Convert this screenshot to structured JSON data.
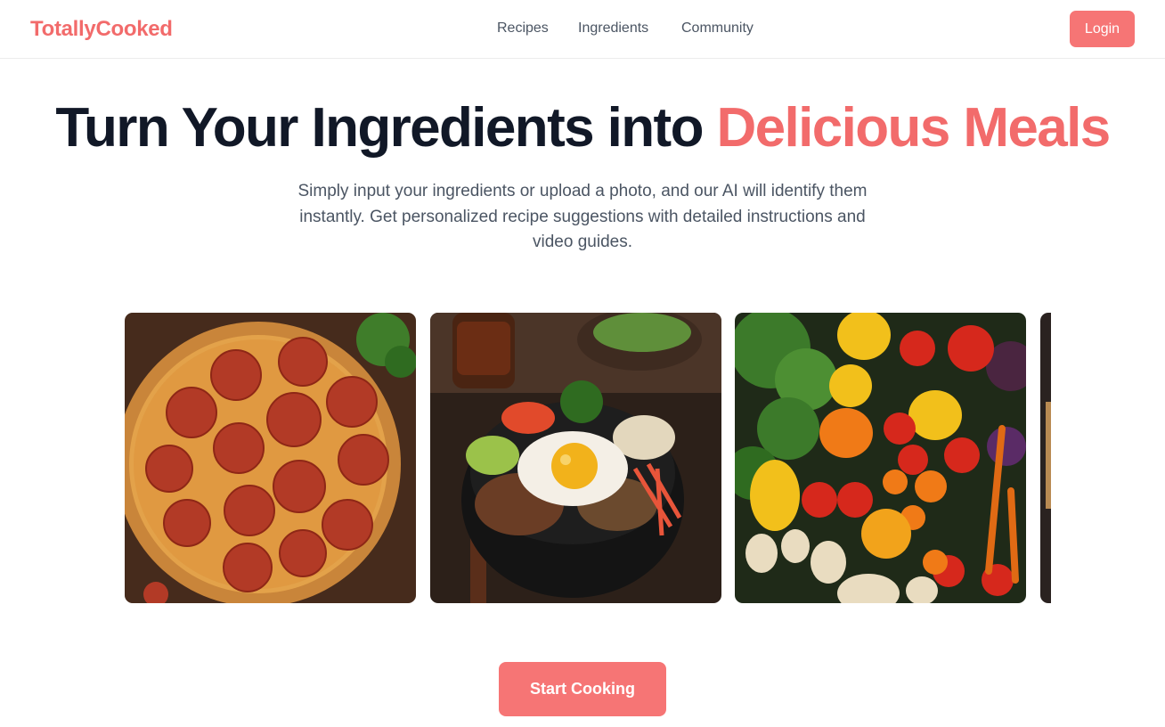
{
  "brand": {
    "name": "TotallyCooked",
    "accent_color": "#f26b6b"
  },
  "nav": {
    "links": [
      "Recipes",
      "Ingredients",
      "Community"
    ],
    "login_label": "Login"
  },
  "hero": {
    "title_main": "Turn Your Ingredients into ",
    "title_accent": "Delicious Meals",
    "subtitle": "Simply input your ingredients or upload a photo, and our AI will identify them instantly. Get personalized recipe suggestions with detailed instructions and video guides."
  },
  "carousel": {
    "images": [
      "pepperoni-pizza-image",
      "bibimbap-bowl-image",
      "vegetables-image",
      "partial-next-image"
    ]
  },
  "cta": {
    "label": "Start Cooking"
  },
  "colors": {
    "primary_button": "#f67575",
    "text_dark": "#111827",
    "text_muted": "#4b5563"
  }
}
